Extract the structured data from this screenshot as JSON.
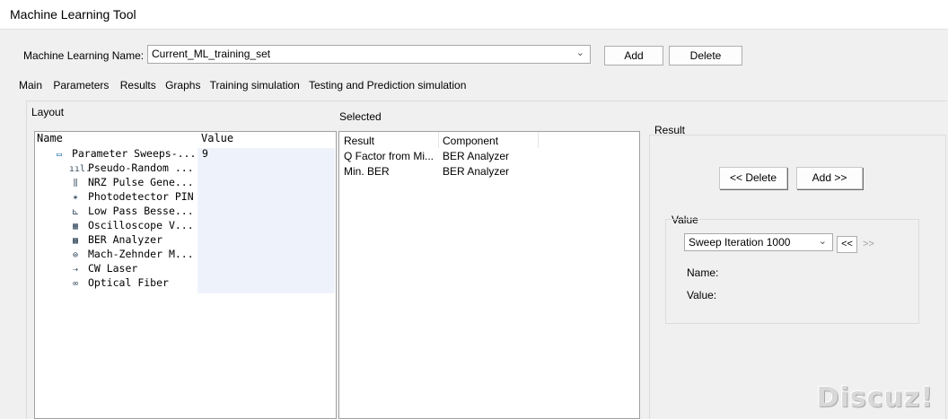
{
  "window": {
    "title": "Machine Learning Tool"
  },
  "ml_name": {
    "label": "Machine Learning Name:",
    "value": "Current_ML_training_set",
    "add_label": "Add",
    "delete_label": "Delete"
  },
  "tabs": [
    {
      "label": "Main"
    },
    {
      "label": "Parameters"
    },
    {
      "label": "Results",
      "selected": true
    },
    {
      "label": "Graphs"
    },
    {
      "label": "Training simulation"
    },
    {
      "label": "Testing and Prediction simulation"
    }
  ],
  "layout": {
    "heading": "Layout",
    "col_name": "Name",
    "col_value": "Value",
    "items": [
      {
        "label": "Parameter Sweeps-...",
        "value": "9",
        "icon": "sweep-icon",
        "glyph": "▭"
      },
      {
        "label": "Pseudo-Random ...",
        "value": "",
        "icon": "prbs-icon",
        "glyph": "ııl."
      },
      {
        "label": "NRZ Pulse Gene...",
        "value": "",
        "icon": "pulse-icon",
        "glyph": "⫼"
      },
      {
        "label": "Photodetector PIN",
        "value": "",
        "icon": "photodetector-icon",
        "glyph": "✶"
      },
      {
        "label": "Low Pass Besse...",
        "value": "",
        "icon": "filter-icon",
        "glyph": "⊾"
      },
      {
        "label": "Oscilloscope V...",
        "value": "",
        "icon": "oscilloscope-icon",
        "glyph": "▦"
      },
      {
        "label": "BER Analyzer",
        "value": "",
        "icon": "ber-analyzer-icon",
        "glyph": "▩"
      },
      {
        "label": "Mach-Zehnder M...",
        "value": "",
        "icon": "modulator-icon",
        "glyph": "⊜"
      },
      {
        "label": "CW Laser",
        "value": "",
        "icon": "laser-icon",
        "glyph": "⇢"
      },
      {
        "label": "Optical Fiber",
        "value": "",
        "icon": "fiber-icon",
        "glyph": "∞"
      }
    ]
  },
  "selected": {
    "heading": "Selected",
    "col_result": "Result",
    "col_component": "Component",
    "rows": [
      {
        "result": "Q Factor from Mi...",
        "component": "BER Analyzer"
      },
      {
        "result": "Min. BER",
        "component": "BER Analyzer"
      }
    ]
  },
  "result": {
    "heading": "Result",
    "delete_label": "<< Delete",
    "add_label": "Add >>",
    "value_group": "Value",
    "sweep_selected": "Sweep Iteration 1000",
    "prev_label": "<<",
    "next_label": ">>",
    "name_label": "Name:",
    "value_label": "Value:"
  },
  "watermark": "Discuz!"
}
